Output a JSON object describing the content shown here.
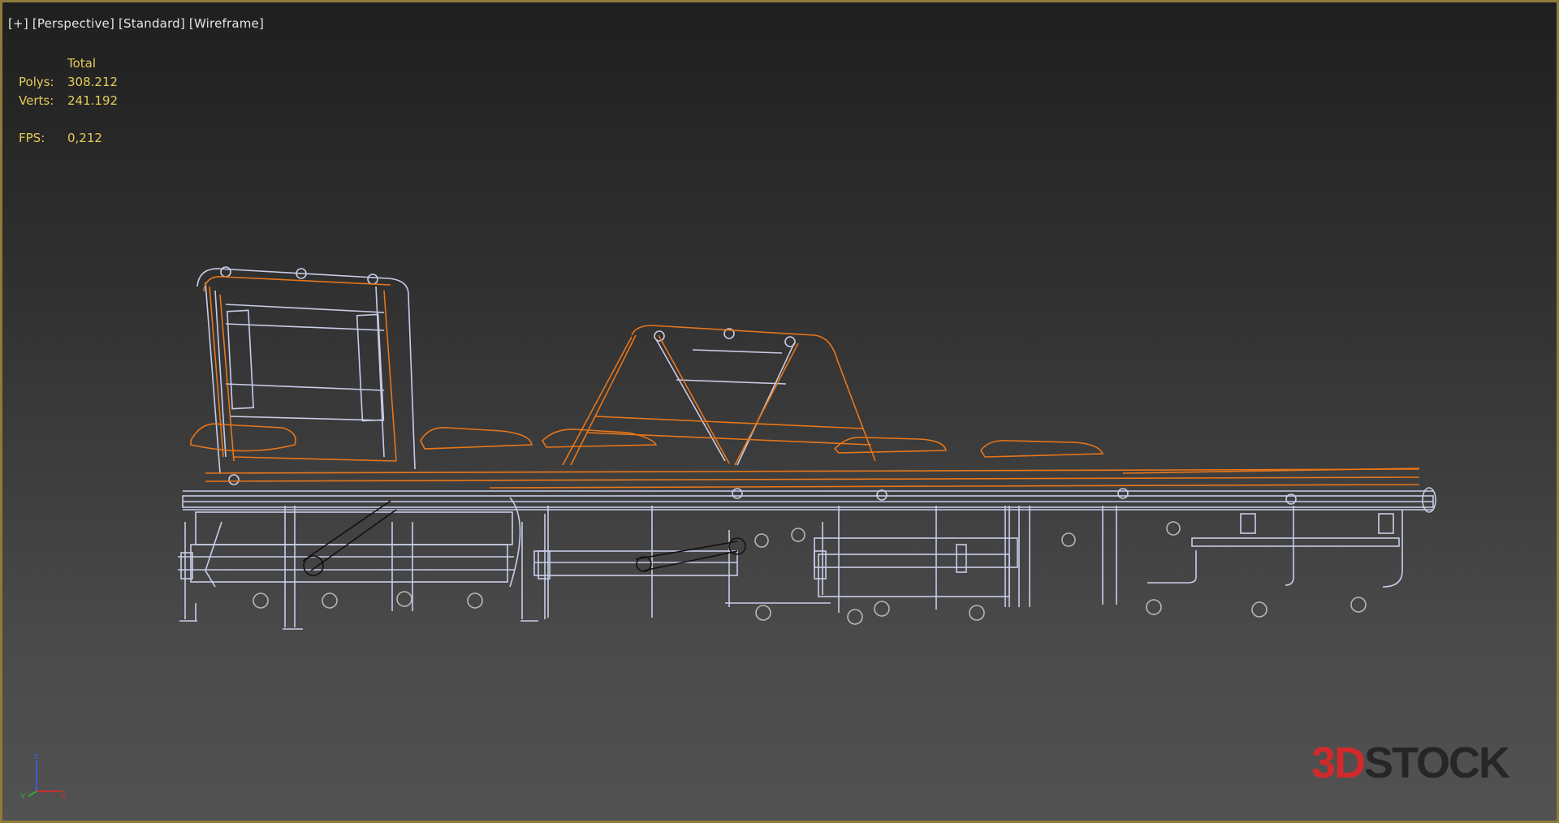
{
  "viewport": {
    "label_parts": [
      "[+]",
      "[Perspective]",
      "[Standard]",
      "[Wireframe]"
    ],
    "stats": {
      "header": "Total",
      "polys_label": "Polys:",
      "polys_value": "308.212",
      "verts_label": "Verts:",
      "verts_value": "241.192",
      "fps_label": "FPS:",
      "fps_value": "0,212"
    },
    "axis_gizmo": {
      "z_label": "z",
      "x_label": "x",
      "y_label": "y"
    },
    "colors": {
      "border": "#8f7a3a",
      "stats_text": "#e4cb58",
      "selected_wire": "#e8761a",
      "unselected_wire": "#c8cde8"
    }
  },
  "watermark": {
    "logo_3d": "3D",
    "logo_text": "STOCK"
  }
}
